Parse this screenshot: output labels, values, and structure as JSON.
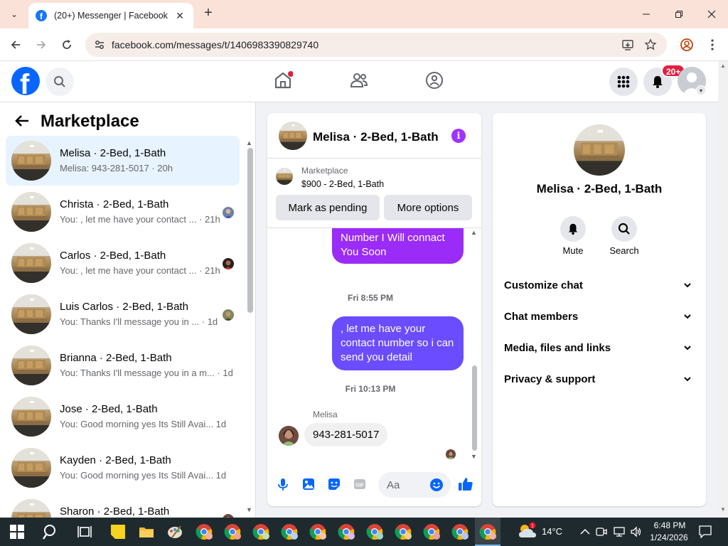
{
  "browser": {
    "tab_title": "(20+) Messenger | Facebook",
    "url": "facebook.com/messages/t/1406983390829740"
  },
  "fb": {
    "notif_badge": "20+"
  },
  "left": {
    "title": "Marketplace",
    "conversations": [
      {
        "name": "Melisa · 2-Bed, 1-Bath",
        "snippet": "Melisa: 943-281-5017 · 20h",
        "active": true
      },
      {
        "name": "Christa · 2-Bed, 1-Bath",
        "snippet": "You: , let me have your contact ... · 21h"
      },
      {
        "name": "Carlos · 2-Bed, 1-Bath",
        "snippet": "You: , let me have your contact ... · 21h"
      },
      {
        "name": "Luis Carlos · 2-Bed, 1-Bath",
        "snippet": "You: Thanks I'll message you in ...  · 1d"
      },
      {
        "name": "Brianna · 2-Bed, 1-Bath",
        "snippet": "You: Thanks I'll message you in a m... · 1d"
      },
      {
        "name": "Jose · 2-Bed, 1-Bath",
        "snippet": "You: Good morning yes Its Still Avai...  1d"
      },
      {
        "name": "Kayden · 2-Bed, 1-Bath",
        "snippet": "You: Good morning yes Its Still Avai...  1d"
      },
      {
        "name": "Sharon · 2-Bed, 1-Bath",
        "snippet": ""
      }
    ]
  },
  "chat": {
    "name": "Melisa · 2-Bed, 1-Bath",
    "marketplace_label": "Marketplace",
    "listing": "$900 - 2-Bed, 1-Bath",
    "mark_pending": "Mark as pending",
    "more_options": "More options",
    "msg1": "Send Your Phone Number I Will connact You Soon",
    "ts1": "Fri 8:55 PM",
    "msg2": ", let me have your contact number so i can send you detail",
    "ts2": "Fri 10:13 PM",
    "sender": "Melisa",
    "msg3": "943-281-5017",
    "input_placeholder": "Aa"
  },
  "info": {
    "name": "Melisa · 2-Bed, 1-Bath",
    "mute": "Mute",
    "search": "Search",
    "sections": [
      "Customize chat",
      "Chat members",
      "Media, files and links",
      "Privacy & support"
    ]
  },
  "taskbar": {
    "weather": "14°C",
    "time": "6:48 PM",
    "date": "1/24/2026",
    "weather_badge": "1"
  },
  "colors": {
    "accent_blue": "#0866ff",
    "bubble_purple": "#a033ff",
    "bubble_blue": "#6b4cff",
    "taskbar": "#1f2a2f"
  }
}
